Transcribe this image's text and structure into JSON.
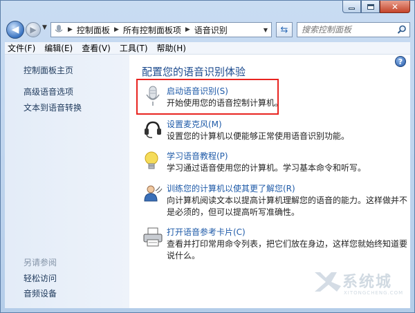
{
  "window": {
    "address": {
      "crumbs": [
        "控制面板",
        "所有控制面板项",
        "语音识别"
      ]
    },
    "search": {
      "placeholder": "搜索控制面板"
    }
  },
  "menu": [
    "文件(F)",
    "编辑(E)",
    "查看(V)",
    "工具(T)",
    "帮助(H)"
  ],
  "sidebar": {
    "home": "控制面板主页",
    "links": [
      "高级语音选项",
      "文本到语音转换"
    ],
    "see_also_heading": "另请参阅",
    "see_also": [
      "轻松访问",
      "音频设备"
    ]
  },
  "main": {
    "title": "配置您的语音识别体验",
    "tasks": [
      {
        "icon": "microphone-icon",
        "link": "启动语音识别(S)",
        "desc": "开始使用您的语音控制计算机。"
      },
      {
        "icon": "headset-icon",
        "link": "设置麦克风(M)",
        "desc": "设置您的计算机以便能够正常使用语音识别功能。"
      },
      {
        "icon": "lightbulb-icon",
        "link": "学习语音教程(P)",
        "desc": "学习通过语音使用您的计算机。学习基本命令和听写。"
      },
      {
        "icon": "user-train-icon",
        "link": "训练您的计算机以使其更了解您(R)",
        "desc": "向计算机阅读文本以提高计算机理解您的语音的能力。这样做并不是必须的，但可以提高听写准确性。"
      },
      {
        "icon": "printer-icon",
        "link": "打开语音参考卡片(C)",
        "desc": "查看并打印常用命令列表，把它们放在身边，这样您就始终知道要说什么。"
      }
    ]
  },
  "watermark": {
    "text": "系统城",
    "sub": "XITONGCHENG.COM"
  },
  "colors": {
    "highlight": "#e8231f",
    "link": "#1e5aa8",
    "title": "#1e4c8f"
  }
}
